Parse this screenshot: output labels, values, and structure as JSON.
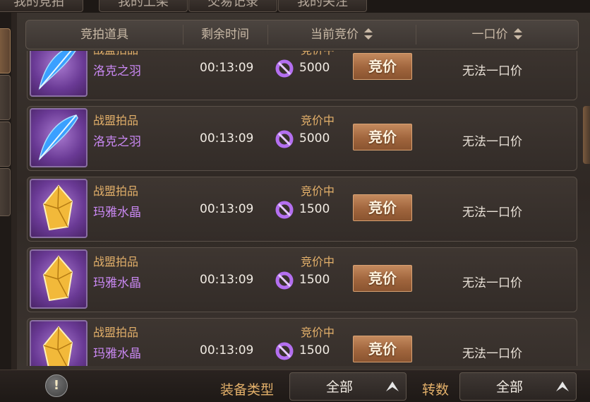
{
  "tabs": [
    "我的竞拍",
    "我的上架",
    "交易记录",
    "我的关注"
  ],
  "header": {
    "item": "竞拍道具",
    "time_left": "剩余时间",
    "current_bid": "当前竞价",
    "buyout": "一口价"
  },
  "rows": [
    {
      "source": "战盟拍品",
      "name": "洛克之羽",
      "time": "00:13:09",
      "status": "竞价中",
      "price": "5000",
      "bid_label": "竞价",
      "buyout": "无法一口价",
      "icon": "feather"
    },
    {
      "source": "战盟拍品",
      "name": "洛克之羽",
      "time": "00:13:09",
      "status": "竞价中",
      "price": "5000",
      "bid_label": "竞价",
      "buyout": "无法一口价",
      "icon": "feather"
    },
    {
      "source": "战盟拍品",
      "name": "玛雅水晶",
      "time": "00:13:09",
      "status": "竞价中",
      "price": "1500",
      "bid_label": "竞价",
      "buyout": "无法一口价",
      "icon": "crystal"
    },
    {
      "source": "战盟拍品",
      "name": "玛雅水晶",
      "time": "00:13:09",
      "status": "竞价中",
      "price": "1500",
      "bid_label": "竞价",
      "buyout": "无法一口价",
      "icon": "crystal"
    },
    {
      "source": "战盟拍品",
      "name": "玛雅水晶",
      "time": "00:13:09",
      "status": "竞价中",
      "price": "1500",
      "bid_label": "竞价",
      "buyout": "无法一口价",
      "icon": "crystal"
    }
  ],
  "filters": {
    "equip_type_label": "装备类型",
    "equip_type_value": "全部",
    "rebirth_label": "转数",
    "rebirth_value": "全部"
  },
  "colors": {
    "source_text": "#e3b06a",
    "item_name": "#c988f2",
    "bid_button": "#a0653d"
  }
}
